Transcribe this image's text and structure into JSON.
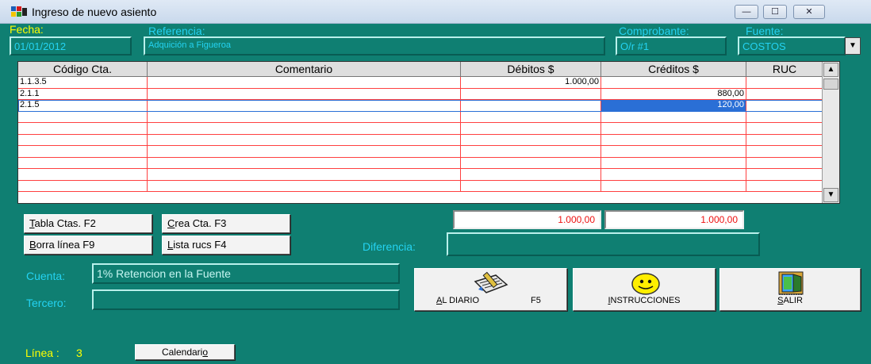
{
  "window": {
    "title": "Ingreso de nuevo asiento",
    "controls": {
      "minimize": "—",
      "maximize": "☐",
      "close": "✕"
    }
  },
  "header": {
    "fecha_label": "Fecha:",
    "fecha_value": "01/01/2012",
    "referencia_label": "Referencia:",
    "referencia_value": "Adquición a Figueroa",
    "comprobante_label": "Comprobante:",
    "comprobante_value": "O/r #1",
    "fuente_label": "Fuente:",
    "fuente_value": "COSTOS",
    "fuente_dropdown_icon": "▼"
  },
  "grid": {
    "columns": [
      "Código Cta.",
      "Comentario",
      "Débitos $",
      "Créditos $",
      "RUC"
    ],
    "rows": [
      [
        "1.1.3.5",
        "",
        "1.000,00",
        "",
        ""
      ],
      [
        "2.1.1",
        "",
        "",
        "880,00",
        ""
      ],
      [
        "2.1.5",
        "",
        "",
        "120,00",
        ""
      ],
      [
        "",
        "",
        "",
        "",
        ""
      ],
      [
        "",
        "",
        "",
        "",
        ""
      ],
      [
        "",
        "",
        "",
        "",
        ""
      ],
      [
        "",
        "",
        "",
        "",
        ""
      ],
      [
        "",
        "",
        "",
        "",
        ""
      ],
      [
        "",
        "",
        "",
        "",
        ""
      ],
      [
        "",
        "",
        "",
        "",
        ""
      ]
    ],
    "selected_row": 2,
    "scroll_up_icon": "▲",
    "scroll_down_icon": "▼"
  },
  "buttons": {
    "tabla_ctas": {
      "pre": "",
      "accel": "T",
      "post": "abla Ctas.  F2"
    },
    "crea_cta": {
      "pre": "",
      "accel": "C",
      "post": "rea Cta.    F3"
    },
    "borra_linea": {
      "pre": "",
      "accel": "B",
      "post": "orra línea  F9"
    },
    "lista_rucs": {
      "pre": "",
      "accel": "L",
      "post": "ista rucs   F4"
    }
  },
  "totals": {
    "debitos": "1.000,00",
    "creditos": "1.000,00",
    "diferencia_label": "Diferencia:",
    "diferencia_value": ""
  },
  "cuenta": {
    "label": "Cuenta:",
    "value": "1% Retencion en la Fuente"
  },
  "tercero": {
    "label": "Tercero:",
    "value": ""
  },
  "actions": {
    "al_diario": {
      "pre": "",
      "accel": "A",
      "post": "L DIARIO",
      "key": "F5",
      "icon": "notepad-pencil-icon"
    },
    "instrucciones": {
      "pre": "",
      "accel": "I",
      "post": "NSTRUCCIONES",
      "icon": "smiley-icon"
    },
    "salir": {
      "pre": "",
      "accel": "S",
      "post": "ALIR",
      "icon": "door-exit-icon"
    }
  },
  "footer": {
    "linea_label": "Línea :",
    "linea_value": "3",
    "calendario": {
      "pre": "Calendari",
      "accel": "o",
      "post": ""
    }
  }
}
